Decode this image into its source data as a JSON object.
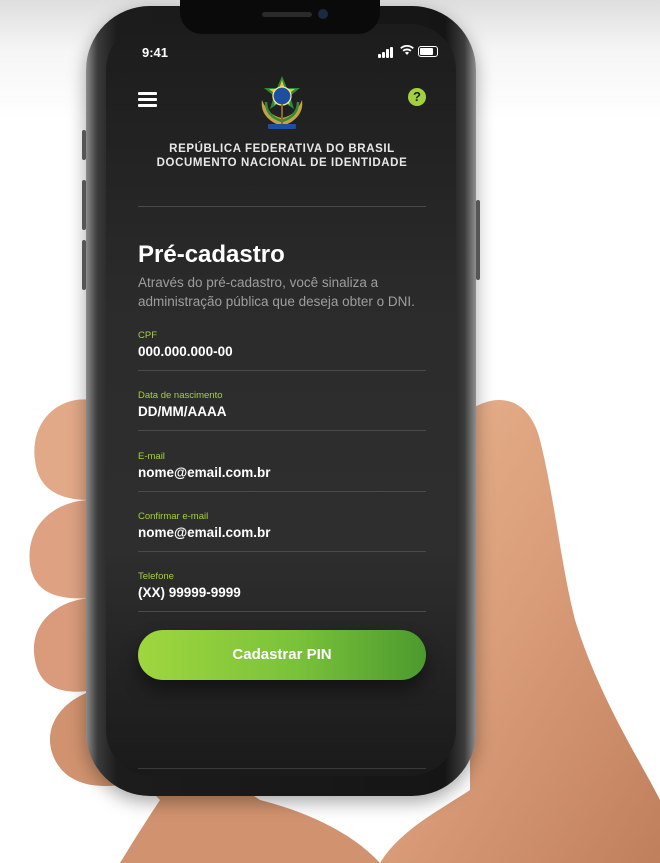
{
  "status_bar": {
    "time": "9:41"
  },
  "header": {
    "gov_line1": "REPÚBLICA FEDERATIVA DO BRASIL",
    "gov_line2": "DOCUMENTO NACIONAL DE IDENTIDADE",
    "help_label": "?"
  },
  "main": {
    "title": "Pré-cadastro",
    "description": "Através do pré-cadastro, você sinaliza a administração pública que deseja obter o DNI."
  },
  "form": {
    "fields": [
      {
        "label": "CPF",
        "value": "000.000.000-00"
      },
      {
        "label": "Data de nascimento",
        "value": "DD/MM/AAAA"
      },
      {
        "label": "E-mail",
        "value": "nome@email.com.br"
      },
      {
        "label": "Confirmar e-mail",
        "value": "nome@email.com.br"
      },
      {
        "label": "Telefone",
        "value": "(XX) 99999-9999"
      }
    ],
    "submit_label": "Cadastrar PIN"
  },
  "icons": {
    "menu": "hamburger-menu-icon",
    "help": "help-icon",
    "coat": "coat-of-arms-icon",
    "signal": "signal-icon",
    "wifi": "wifi-icon",
    "battery": "battery-icon"
  },
  "colors": {
    "accent": "#a2d13f",
    "screen_bg": "#2a2a2a",
    "text_primary": "#ffffff",
    "text_muted": "#9e9e9e"
  }
}
